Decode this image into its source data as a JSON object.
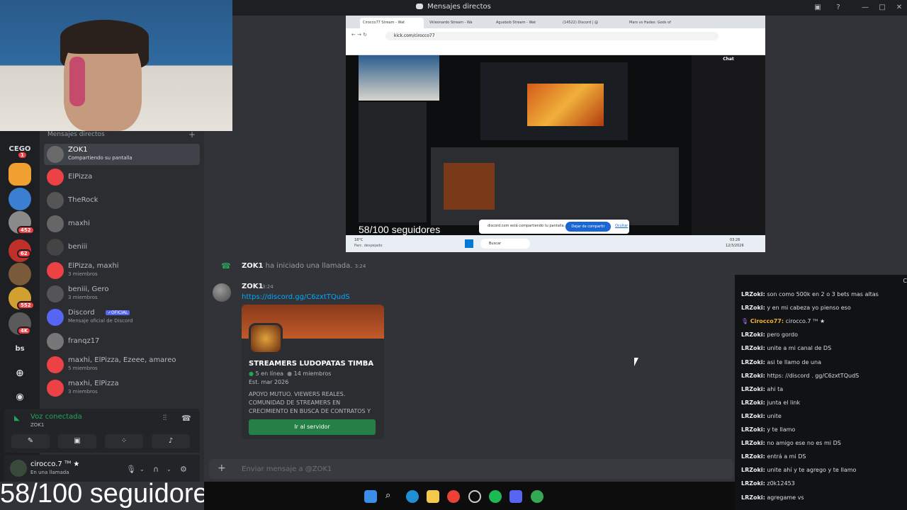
{
  "window": {
    "title": "Mensajes directos"
  },
  "webcam": {
    "overlay_small": "58/100 seguidores",
    "overlay_big": "58/100 seguidores"
  },
  "servers": [
    {
      "label": "CEGO",
      "badge": "1"
    },
    {
      "label": "",
      "badge": ""
    },
    {
      "label": "",
      "badge": ""
    },
    {
      "label": "",
      "badge": "452"
    },
    {
      "label": "",
      "badge": "62"
    },
    {
      "label": "",
      "badge": ""
    },
    {
      "label": "",
      "badge": "552"
    },
    {
      "label": "",
      "badge": "4K"
    },
    {
      "label": "bs",
      "badge": ""
    }
  ],
  "dm": {
    "header": "Mensajes directos",
    "items": [
      {
        "name": "ZOK1",
        "sub": "Compartiendo su pantalla",
        "color": "#6a6a6a",
        "selected": true
      },
      {
        "name": "ElPizza",
        "sub": "",
        "color": "#ed4245"
      },
      {
        "name": "TheRock",
        "sub": "",
        "color": "#555"
      },
      {
        "name": "maxhi",
        "sub": "",
        "color": "#666"
      },
      {
        "name": "beniii",
        "sub": "",
        "color": "#444"
      },
      {
        "name": "ElPizza, maxhi",
        "sub": "3 miembros",
        "color": "#ed4245"
      },
      {
        "name": "beniii, Gero",
        "sub": "3 miembros",
        "color": "#555"
      },
      {
        "name": "Discord",
        "sub": "Mensaje oficial de Discord",
        "color": "#5865f2",
        "badge": "✓OFICIAL"
      },
      {
        "name": "franqz17",
        "sub": "",
        "color": "#777"
      },
      {
        "name": "maxhi, ElPizza, Ezeee, amareo",
        "sub": "5 miembros",
        "color": "#ed4245"
      },
      {
        "name": "maxhi, ElPizza",
        "sub": "3 miembros",
        "color": "#ed4245"
      }
    ]
  },
  "voice": {
    "status": "Voz conectada",
    "channel": "ZOK1"
  },
  "user": {
    "name": "cirocco.7 ᵀᴹ ★",
    "status": "En una llamada"
  },
  "share": {
    "tabs": [
      "Cirocco77 Stream - Wat",
      "Vkleonardo Stream - Wa",
      "Agusbob Stream - Wat",
      "(14522) Discord | @",
      "Mars vs Hades: Gods of"
    ],
    "url": "kick.com/cirocco77",
    "sharebar_text": "discord.com está compartiendo tu pantalla.",
    "sharebar_button": "Dejar de compartir",
    "sharebar_hide": "Ocultar",
    "chat_header": "Chat",
    "search": "Buscar",
    "temp": "18°C",
    "weather": "Parc. despejado",
    "time": "03:26",
    "date": "12/3/2026"
  },
  "chat": {
    "call_user": "ZOK1",
    "call_text": "ha iniciado una llamada.",
    "call_time": "3:24",
    "msg_user": "ZOK1",
    "msg_time": "3:24",
    "msg_link": "https://discord.gg/C6zxtTQudS",
    "invite": {
      "name": "STREAMERS LUDOPATAS TIMBA",
      "online": "5 en línea",
      "members": "14 miembros",
      "est": "Est. mar 2026",
      "desc": "APOYO MUTUO. VIEWERS REALES. COMUNIDAD DE STREAMERS EN CRECIMIENTO EN BUSCA DE CONTRATOS Y",
      "button": "Ir al servidor"
    },
    "composer_placeholder": "Enviar mensaje a @ZOK1"
  },
  "right_chat": [
    {
      "user": "LRZoki:",
      "text": "son como 500k en 2 o 3 bets mas altas"
    },
    {
      "user": "LRZoki:",
      "text": "y en mi cabeza yo pienso eso"
    },
    {
      "user": "Cirocco77:",
      "text": "cirocco.7 ᵀᴹ ★",
      "highlight": true
    },
    {
      "user": "LRZoki:",
      "text": "pero gordo"
    },
    {
      "user": "LRZoki:",
      "text": "unite a mi canal de DS"
    },
    {
      "user": "LRZoki:",
      "text": "asi te llamo de una"
    },
    {
      "user": "LRZoki:",
      "text": "https: //discord . gg/C6zxtTQudS"
    },
    {
      "user": "LRZoki:",
      "text": "ahi ta"
    },
    {
      "user": "LRZoki:",
      "text": "junta el link"
    },
    {
      "user": "LRZoki:",
      "text": "unite"
    },
    {
      "user": "LRZoki:",
      "text": "y te llamo"
    },
    {
      "user": "LRZoki:",
      "text": "no amigo ese no es mi DS"
    },
    {
      "user": "LRZoki:",
      "text": "entrá a mi DS"
    },
    {
      "user": "LRZoki:",
      "text": "unite ahí y te agrego y te llamo"
    },
    {
      "user": "LRZoki:",
      "text": "z0k12453"
    },
    {
      "user": "LRZoki:",
      "text": "agregame vs"
    }
  ],
  "right_close": "C"
}
